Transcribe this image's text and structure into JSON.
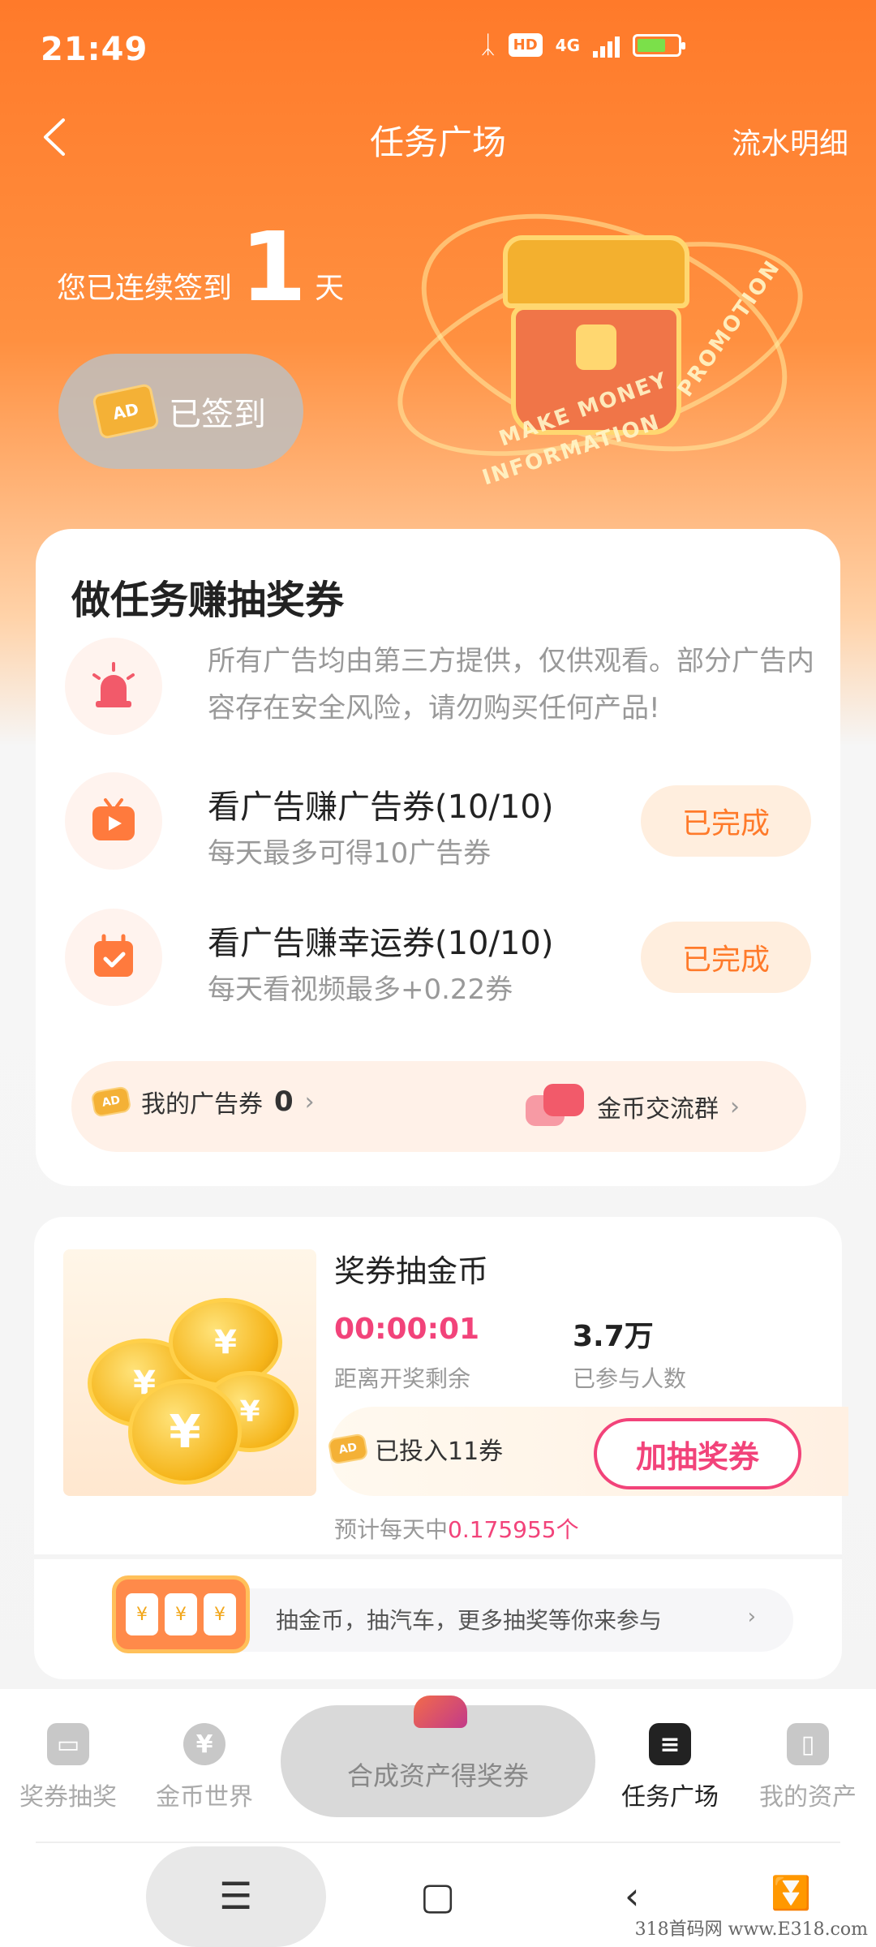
{
  "status_bar": {
    "time": "21:49",
    "network": "4G",
    "hd": "HD"
  },
  "nav": {
    "back_label": "<",
    "title": "任务广场",
    "right_link": "流水明细"
  },
  "checkin": {
    "prefix": "您已连续签到",
    "days": "1",
    "suffix": "天",
    "button_label": "已签到",
    "ticket_text": "AD"
  },
  "hero_art": {
    "words": [
      "MAKE MONEY",
      "INFORMATION",
      "PROMOTION",
      "AD"
    ]
  },
  "task_card": {
    "title": "做任务赚抽奖券",
    "notice": "所有广告均由第三方提供，仅供观看。部分广告内容存在安全风险，请勿购买任何产品!",
    "tasks": [
      {
        "title": "看广告赚广告券(10/10)",
        "subtitle": "每天最多可得10广告券",
        "button": "已完成",
        "icon": "tv-icon"
      },
      {
        "title": "看广告赚幸运券(10/10)",
        "subtitle": "每天看视频最多+0.22券",
        "button": "已完成",
        "icon": "calendar-check-icon"
      }
    ],
    "my_tickets_label": "我的广告券",
    "my_tickets_count": "0",
    "group_label": "金币交流群"
  },
  "lottery": {
    "title": "奖券抽金币",
    "timer": "00:00:01",
    "timer_label": "距离开奖剩余",
    "participants": "3.7万",
    "participants_label": "已参与人数",
    "invested": "已投入11券",
    "add_button": "加抽奖券",
    "estimate_prefix": "预计每天中",
    "estimate_value": "0.175955个",
    "promo_text": "抽金币，抽汽车，更多抽奖等你来参与",
    "coin_symbol": "¥"
  },
  "tabbar": {
    "items": [
      {
        "label": "奖券抽奖",
        "icon": "gift-icon",
        "active": false
      },
      {
        "label": "金币世界",
        "icon": "yen-icon",
        "active": false
      },
      {
        "label": "合成资产得奖券",
        "icon": "gem-icon",
        "active": false
      },
      {
        "label": "任务广场",
        "icon": "task-list-icon",
        "active": true
      },
      {
        "label": "我的资产",
        "icon": "wallet-icon",
        "active": false
      }
    ]
  },
  "watermark": "318首码网 www.E318.com",
  "colors": {
    "primary": "#ff7a2a",
    "accent_pink": "#f2437a",
    "gold": "#f4b136"
  }
}
